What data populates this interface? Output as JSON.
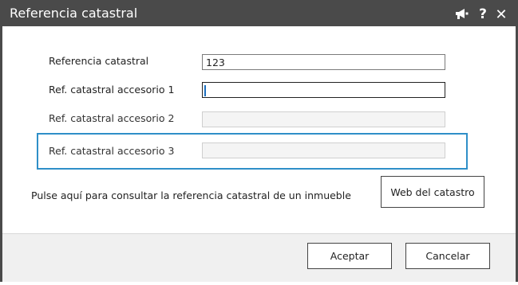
{
  "window": {
    "title": "Referencia catastral",
    "help_glyph": "?",
    "close_glyph": "✕"
  },
  "form": {
    "fields": [
      {
        "label": "Referencia catastral",
        "value": "123"
      },
      {
        "label": "Ref. catastral accesorio 1",
        "value": ""
      },
      {
        "label": "Ref. catastral accesorio 2",
        "value": ""
      },
      {
        "label": "Ref. catastral accesorio 3",
        "value": ""
      }
    ],
    "hint_text": "Pulse aquí para consultar la referencia catastral de un inmueble",
    "web_button_label": "Web del catastro"
  },
  "footer": {
    "accept_label": "Aceptar",
    "cancel_label": "Cancelar"
  },
  "colors": {
    "titlebar": "#4a4a4a",
    "highlight": "#2f8fc8",
    "caret": "#1b6fbf"
  }
}
